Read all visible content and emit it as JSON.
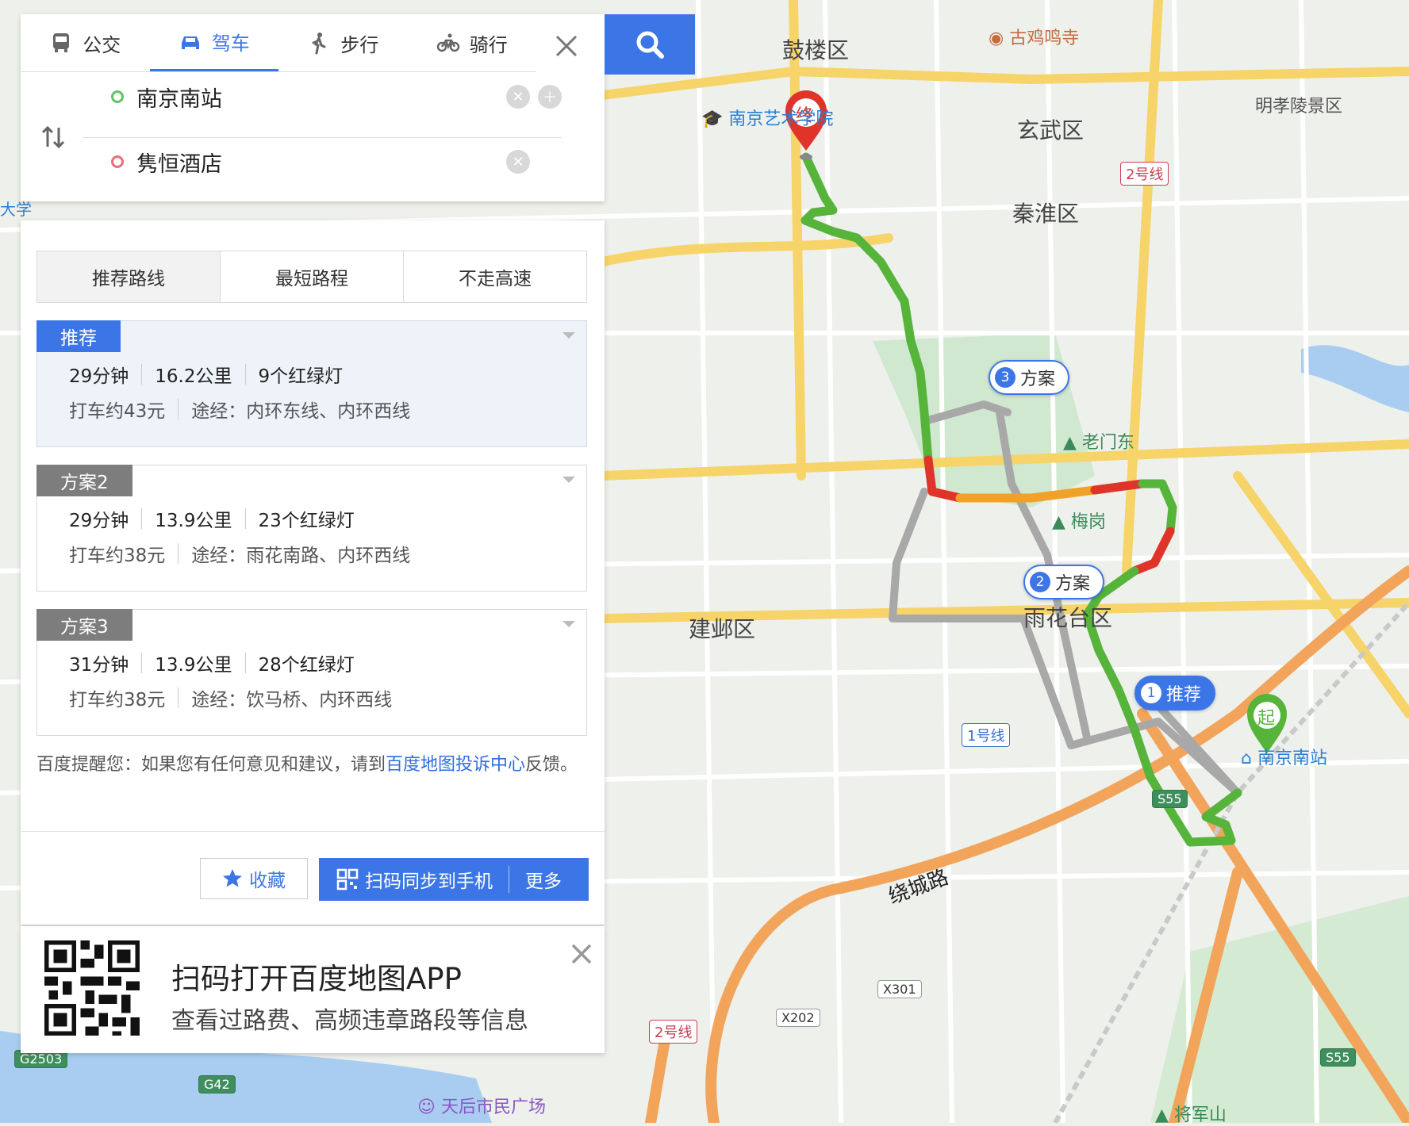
{
  "map": {
    "districts": [
      {
        "name": "鼓楼区",
        "pos": "top-center"
      },
      {
        "name": "玄武区",
        "pos": "top-right"
      },
      {
        "name": "秦淮区",
        "pos": "upper-right"
      },
      {
        "name": "建邺区",
        "pos": "left-center"
      },
      {
        "name": "雨花台区",
        "pos": "center-right"
      }
    ],
    "pois": [
      {
        "name": "古鸡鸣寺"
      },
      {
        "name": "明孝陵景区"
      },
      {
        "name": "南京艺术学院"
      },
      {
        "name": "老门东"
      },
      {
        "name": "梅岗"
      },
      {
        "name": "南京南站"
      },
      {
        "name": "天后市民广场"
      },
      {
        "name": "将军山"
      },
      {
        "name": "大学"
      }
    ],
    "road_labels": [
      "绕城路"
    ],
    "shields": [
      "S55",
      "X301",
      "X202",
      "G42",
      "G2503",
      "S55"
    ],
    "metro_labels": [
      "2号线",
      "2号线",
      "1号线"
    ],
    "bubbles": [
      {
        "num": "1",
        "text": "推荐",
        "selected": true
      },
      {
        "num": "2",
        "text": "方案",
        "selected": false
      },
      {
        "num": "3",
        "text": "方案",
        "selected": false
      }
    ],
    "markers": {
      "start": "起",
      "end": "终"
    },
    "colors": {
      "route_green": "#56b43a",
      "route_red": "#e0332a",
      "route_orange": "#f0a228",
      "route_gray": "#a8a8a8",
      "accent_blue": "#3c76e6",
      "road_yellow": "#f7d46a",
      "road_orange": "#f2a45b",
      "water": "#a9cdf0"
    }
  },
  "search": {
    "mode_tabs": [
      {
        "label": "公交",
        "icon": "bus-icon"
      },
      {
        "label": "驾车",
        "icon": "car-icon",
        "active": true
      },
      {
        "label": "步行",
        "icon": "walk-icon"
      },
      {
        "label": "骑行",
        "icon": "bike-icon"
      }
    ],
    "origin": "南京南站",
    "destination": "隽恒酒店"
  },
  "routes": {
    "strategy_tabs": [
      "推荐路线",
      "最短路程",
      "不走高速"
    ],
    "active_strategy": "推荐路线",
    "options": [
      {
        "tag": "推荐",
        "time": "29分钟",
        "distance": "16.2公里",
        "lights": "9个红绿灯",
        "taxi": "打车约43元",
        "via_label": "途经：",
        "via": "内环东线、内环西线",
        "active": true
      },
      {
        "tag": "方案2",
        "time": "29分钟",
        "distance": "13.9公里",
        "lights": "23个红绿灯",
        "taxi": "打车约38元",
        "via_label": "途经：",
        "via": "雨花南路、内环西线",
        "active": false
      },
      {
        "tag": "方案3",
        "time": "31分钟",
        "distance": "13.9公里",
        "lights": "28个红绿灯",
        "taxi": "打车约38元",
        "via_label": "途经：",
        "via": "饮马桥、内环西线",
        "active": false
      }
    ],
    "tip_prefix": "百度提醒您：如果您有任何意见和建议，请到",
    "tip_link": "百度地图投诉中心",
    "tip_suffix": "反馈。",
    "fav_label": "收藏",
    "sync_label": "扫码同步到手机",
    "more_label": "更多"
  },
  "promo": {
    "title": "扫码打开百度地图APP",
    "subtitle": "查看过路费、高频违章路段等信息"
  }
}
